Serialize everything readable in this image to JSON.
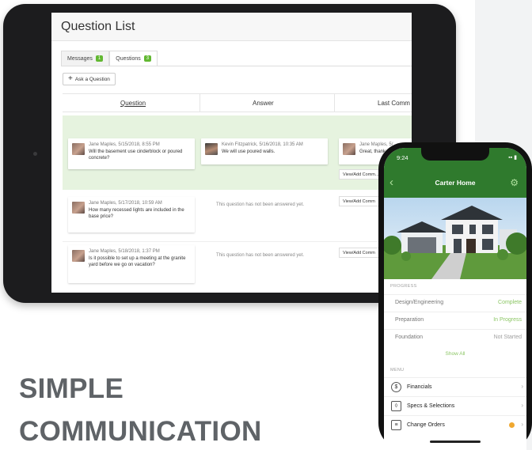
{
  "tablet": {
    "title": "Question List",
    "tabs": [
      {
        "label": "Messages",
        "count": "1"
      },
      {
        "label": "Questions",
        "count": "3"
      }
    ],
    "ask_button": "Ask a Question",
    "columns": [
      "Question",
      "Answer",
      "Last Comm"
    ],
    "rows": [
      {
        "meta": "Jane Maples, 5/15/2018, 8:55 PM",
        "question": "Will the basement use cinderblock or poured concrete?",
        "answer_meta": "Kevin Fitzpatrick, 5/16/2018, 10:35 AM",
        "answer": "We will use poured walls.",
        "last_meta": "Jane Maples, 5/",
        "last_text": "Great, thank",
        "button": "View/Add Comm..."
      },
      {
        "meta": "Jane Maples, 5/17/2018, 10:59 AM",
        "question": "How many recessed lights are included in the base price?",
        "answer_status": "This question has not been answered yet.",
        "button": "View/Add Comm"
      },
      {
        "meta": "Jane Maples, 5/18/2018, 1:37 PM",
        "question": "Is it possible to set up a meeting at the granite yard before we go on vacation?",
        "answer_status": "This question has not been answered yet.",
        "button": "View/Add Comm"
      }
    ]
  },
  "phone": {
    "time": "9:24",
    "title": "Carter Home",
    "progress_label": "PROGRESS",
    "progress": [
      {
        "label": "Design/Engineering",
        "status": "Complete",
        "color": "#8cc665"
      },
      {
        "label": "Preparation",
        "status": "In Progress",
        "color": "#8cc665"
      },
      {
        "label": "Foundation",
        "status": "Not Started",
        "color": "#a0a0a0"
      }
    ],
    "show_all": "Show All",
    "menu_label": "MENU",
    "menu": [
      {
        "label": "Financials",
        "icon": "dollar-icon"
      },
      {
        "label": "Specs & Selections",
        "icon": "tag-icon"
      },
      {
        "label": "Change Orders",
        "icon": "document-icon",
        "badge": true
      }
    ]
  },
  "headline": {
    "line1": "SIMPLE",
    "line2": "COMMUNICATION"
  },
  "colors": {
    "brand_green": "#2f7a2d",
    "accent_green": "#8cc665",
    "highlight_row": "#e6f3df",
    "badge_green": "#62b832"
  }
}
